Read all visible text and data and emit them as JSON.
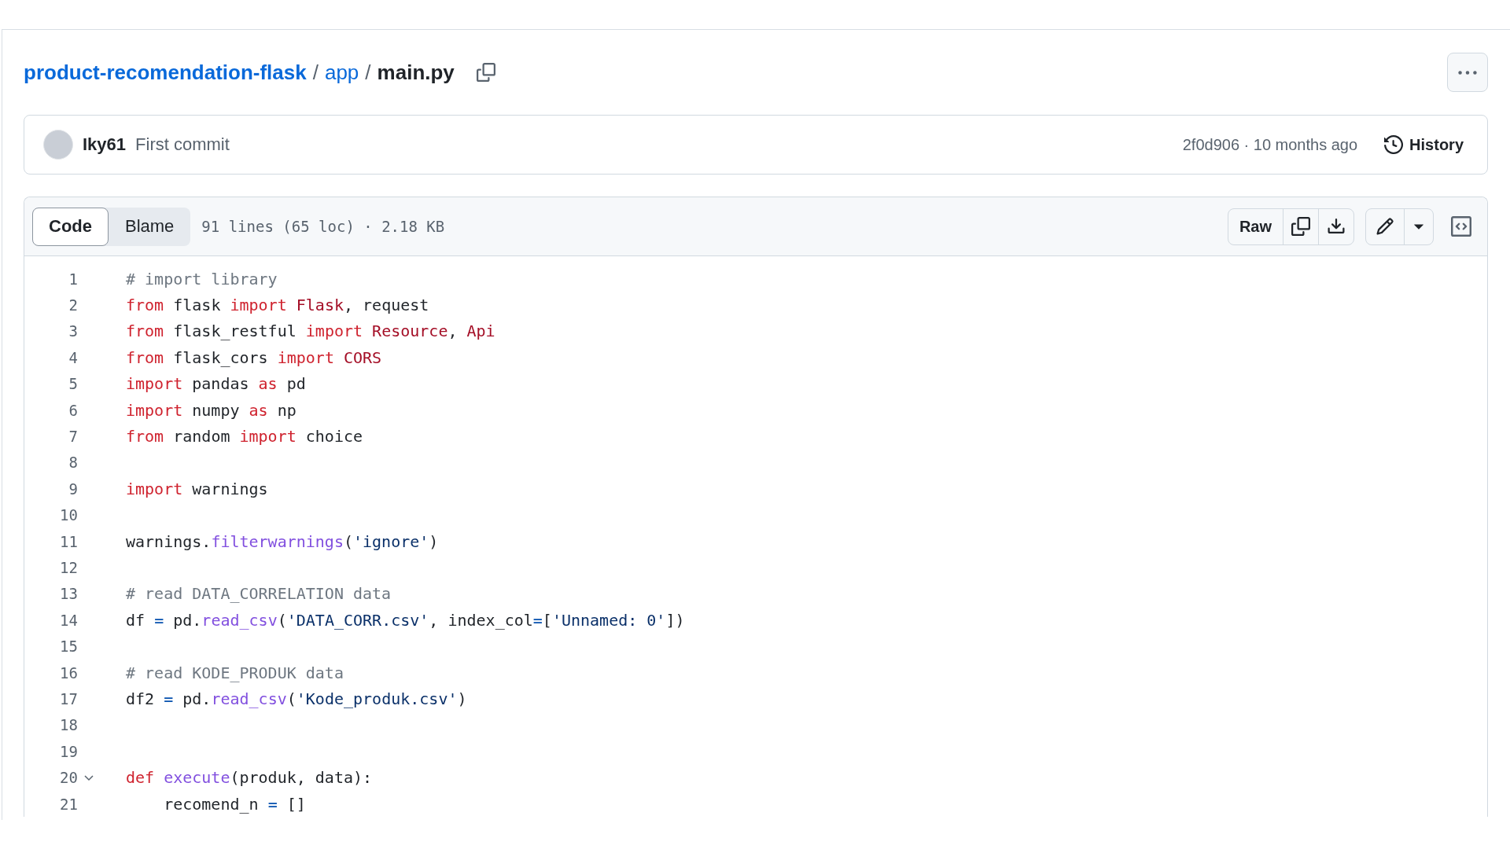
{
  "breadcrumb": {
    "repo": "product-recomendation-flask",
    "separator_1": "/",
    "folder": "app",
    "separator_2": "/",
    "file": "main.py"
  },
  "commit": {
    "author": "Iky61",
    "message": "First commit",
    "meta": "2f0d906 · 10 months ago",
    "history": "History"
  },
  "view_tabs": [
    {
      "label": "Code",
      "selected": true
    },
    {
      "label": "Blame",
      "selected": false
    }
  ],
  "file_info": "91 lines (65 loc) · 2.18 KB",
  "raw_button": "Raw",
  "lines": [
    {
      "number": "1",
      "tokens": [
        {
          "kind": "cmt",
          "text": "# import library"
        }
      ]
    },
    {
      "number": "2",
      "tokens": [
        {
          "kind": "kw",
          "text": "from"
        },
        {
          "kind": "plain",
          "text": " flask "
        },
        {
          "kind": "kw",
          "text": "import"
        },
        {
          "kind": "cls",
          "text": " Flask"
        },
        {
          "kind": "plain",
          "text": ", request"
        }
      ]
    },
    {
      "number": "3",
      "tokens": [
        {
          "kind": "kw",
          "text": "from"
        },
        {
          "kind": "plain",
          "text": " flask_restful "
        },
        {
          "kind": "kw",
          "text": "import"
        },
        {
          "kind": "cls",
          "text": " Resource"
        },
        {
          "kind": "plain",
          "text": ", "
        },
        {
          "kind": "cls",
          "text": "Api"
        }
      ]
    },
    {
      "number": "4",
      "tokens": [
        {
          "kind": "kw",
          "text": "from"
        },
        {
          "kind": "plain",
          "text": " flask_cors "
        },
        {
          "kind": "kw",
          "text": "import"
        },
        {
          "kind": "cls",
          "text": " CORS"
        }
      ]
    },
    {
      "number": "5",
      "tokens": [
        {
          "kind": "kw",
          "text": "import"
        },
        {
          "kind": "plain",
          "text": " pandas "
        },
        {
          "kind": "kw",
          "text": "as"
        },
        {
          "kind": "plain",
          "text": " pd"
        }
      ]
    },
    {
      "number": "6",
      "tokens": [
        {
          "kind": "kw",
          "text": "import"
        },
        {
          "kind": "plain",
          "text": " numpy "
        },
        {
          "kind": "kw",
          "text": "as"
        },
        {
          "kind": "plain",
          "text": " np"
        }
      ]
    },
    {
      "number": "7",
      "tokens": [
        {
          "kind": "kw",
          "text": "from"
        },
        {
          "kind": "plain",
          "text": " random "
        },
        {
          "kind": "kw",
          "text": "import"
        },
        {
          "kind": "plain",
          "text": " choice"
        }
      ]
    },
    {
      "number": "8"
    },
    {
      "number": "9",
      "tokens": [
        {
          "kind": "kw",
          "text": "import"
        },
        {
          "kind": "plain",
          "text": " warnings"
        }
      ]
    },
    {
      "number": "10"
    },
    {
      "number": "11",
      "tokens": [
        {
          "kind": "plain",
          "text": "warnings."
        },
        {
          "kind": "fn",
          "text": "filterwarnings"
        },
        {
          "kind": "plain",
          "text": "("
        },
        {
          "kind": "str",
          "text": "'ignore'"
        },
        {
          "kind": "plain",
          "text": ")"
        }
      ]
    },
    {
      "number": "12"
    },
    {
      "number": "13",
      "tokens": [
        {
          "kind": "cmt",
          "text": "# read DATA_CORRELATION data"
        }
      ]
    },
    {
      "number": "14",
      "tokens": [
        {
          "kind": "plain",
          "text": "df "
        },
        {
          "kind": "op",
          "text": "="
        },
        {
          "kind": "plain",
          "text": " pd."
        },
        {
          "kind": "fn",
          "text": "read_csv"
        },
        {
          "kind": "plain",
          "text": "("
        },
        {
          "kind": "str",
          "text": "'DATA_CORR.csv'"
        },
        {
          "kind": "plain",
          "text": ", index_col"
        },
        {
          "kind": "op",
          "text": "="
        },
        {
          "kind": "plain",
          "text": "["
        },
        {
          "kind": "str",
          "text": "'Unnamed: 0'"
        },
        {
          "kind": "plain",
          "text": "])"
        }
      ]
    },
    {
      "number": "15"
    },
    {
      "number": "16",
      "tokens": [
        {
          "kind": "cmt",
          "text": "# read KODE_PRODUK data"
        }
      ]
    },
    {
      "number": "17",
      "tokens": [
        {
          "kind": "plain",
          "text": "df2 "
        },
        {
          "kind": "op",
          "text": "="
        },
        {
          "kind": "plain",
          "text": " pd."
        },
        {
          "kind": "fn",
          "text": "read_csv"
        },
        {
          "kind": "plain",
          "text": "("
        },
        {
          "kind": "str",
          "text": "'Kode_produk.csv'"
        },
        {
          "kind": "plain",
          "text": ")"
        }
      ]
    },
    {
      "number": "18"
    },
    {
      "number": "19"
    },
    {
      "number": "20",
      "expanded": true,
      "tokens": [
        {
          "kind": "kw",
          "text": "def"
        },
        {
          "kind": "fn",
          "text": " execute"
        },
        {
          "kind": "plain",
          "text": "(produk, data):"
        }
      ]
    },
    {
      "number": "21",
      "tokens": [
        {
          "kind": "plain",
          "text": "    recomend_n "
        },
        {
          "kind": "op",
          "text": "="
        },
        {
          "kind": "plain",
          "text": " []"
        }
      ]
    }
  ]
}
